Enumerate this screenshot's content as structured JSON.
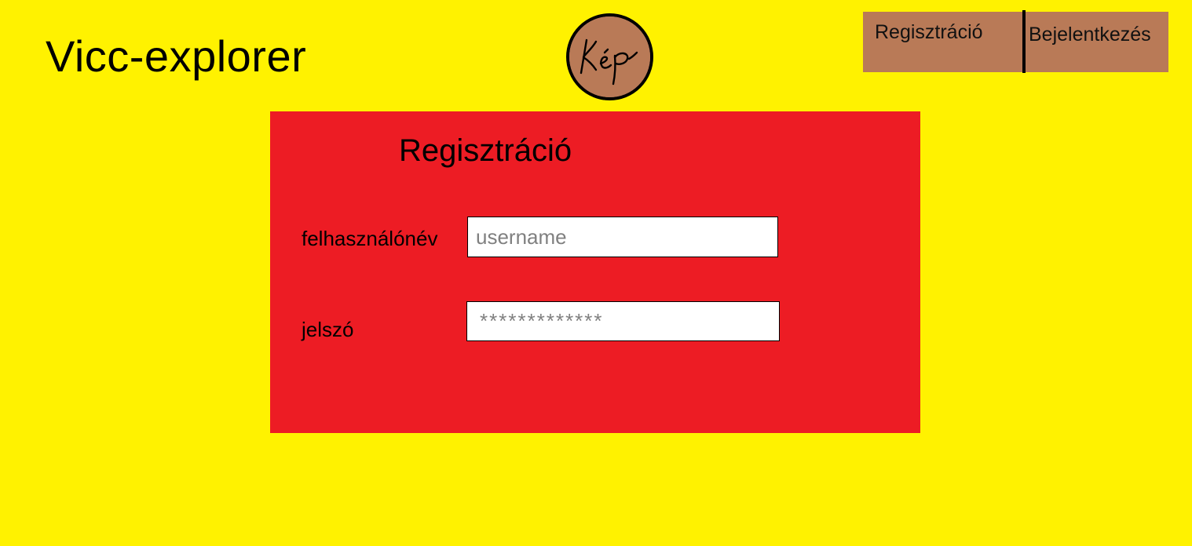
{
  "colors": {
    "page_background": "#fff200",
    "panel_background": "#ed1c24",
    "nav_button_background": "#b97a57",
    "nav_divider": "#000000",
    "logo_background": "#b97a57"
  },
  "header": {
    "app_title": "Vicc-explorer",
    "logo": {
      "icon": "handwritten-picture-placeholder-logo",
      "text": "Kép"
    },
    "nav": {
      "register_label": "Regisztráció",
      "login_label": "Bejelentkezés"
    }
  },
  "registration_form": {
    "title": "Regisztráció",
    "username": {
      "label": "felhasználónév",
      "placeholder": "username",
      "value": ""
    },
    "password": {
      "label": "jelszó",
      "placeholder": "*************",
      "value": ""
    }
  }
}
